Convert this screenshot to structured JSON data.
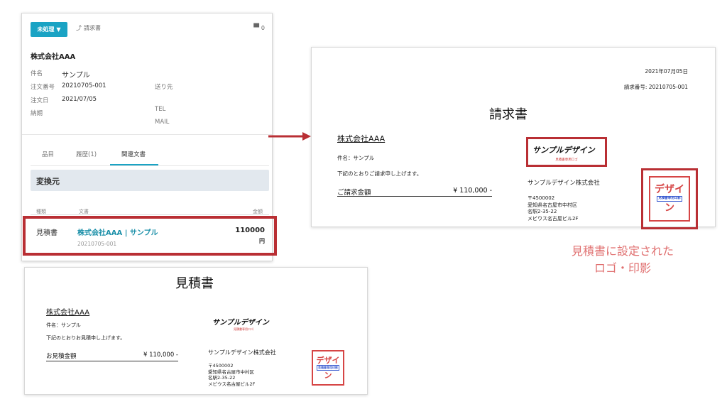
{
  "detail": {
    "status_label": "未処理",
    "invoice_link": "請求書",
    "comment_count": "0",
    "company": "株式会社AAA",
    "fields": {
      "subject_label": "件名",
      "subject_value": "サンプル",
      "order_no_label": "注文番号",
      "order_no_value": "20210705-001",
      "order_date_label": "注文日",
      "order_date_value": "2021/07/05",
      "delivery_label": "納期",
      "ship_to_label": "送り先",
      "tel_label": "TEL",
      "mail_label": "MAIL"
    },
    "tabs": [
      "品目",
      "履歴(1)",
      "関連文書"
    ],
    "section_title": "変換元",
    "columns": {
      "type": "種類",
      "doc": "文書",
      "amount": "金額"
    },
    "row": {
      "type": "見積書",
      "doc_title": "株式会社AAA | サンプル",
      "doc_number": "20210705-001",
      "amount": "110000",
      "currency": "円"
    }
  },
  "invoice": {
    "date": "2021年07月05日",
    "number": "請求番号: 20210705-001",
    "title": "請求書",
    "customer": "株式会社AAA",
    "subject": "件名：サンプル",
    "intro": "下記のとおりご請求申し上げます。",
    "total_label": "ご請求金額",
    "total_value": "¥ 110,000 -",
    "logo_text": "サンプルデザイン",
    "logo_sub": "見積書専用ロゴ",
    "issuer": "サンプルデザイン株式会社",
    "postal": "〒4500002",
    "address1": "愛知県名古屋市中村区",
    "address2": "名駅2-35-22",
    "address3": "メビウス名古屋ビル2F",
    "seal_top": "デザイ",
    "seal_mid": "見積書専用印影",
    "seal_bottom": "ン"
  },
  "estimate": {
    "title": "見積書",
    "customer": "株式会社AAA",
    "subject": "件名：サンプル",
    "intro": "下記のとおりお見積申し上げます。",
    "total_label": "お見積金額",
    "total_value": "¥ 110,000 -",
    "logo_text": "サンプルデザイン",
    "logo_sub": "見積書専用ロゴ",
    "issuer": "サンプルデザイン株式会社",
    "postal": "〒4500002",
    "address1": "愛知県名古屋市中村区",
    "address2": "名駅2-35-22",
    "address3": "メビウス名古屋ビル2F",
    "seal_top": "デザイ",
    "seal_mid": "見積書専用印影",
    "seal_bottom": "ン"
  },
  "caption": {
    "line1": "見積書に設定された",
    "line2": "ロゴ・印影"
  },
  "colors": {
    "accent": "#1aa3c4",
    "highlight": "#b92f34",
    "caption": "#e07070",
    "seal": "#d64545"
  }
}
